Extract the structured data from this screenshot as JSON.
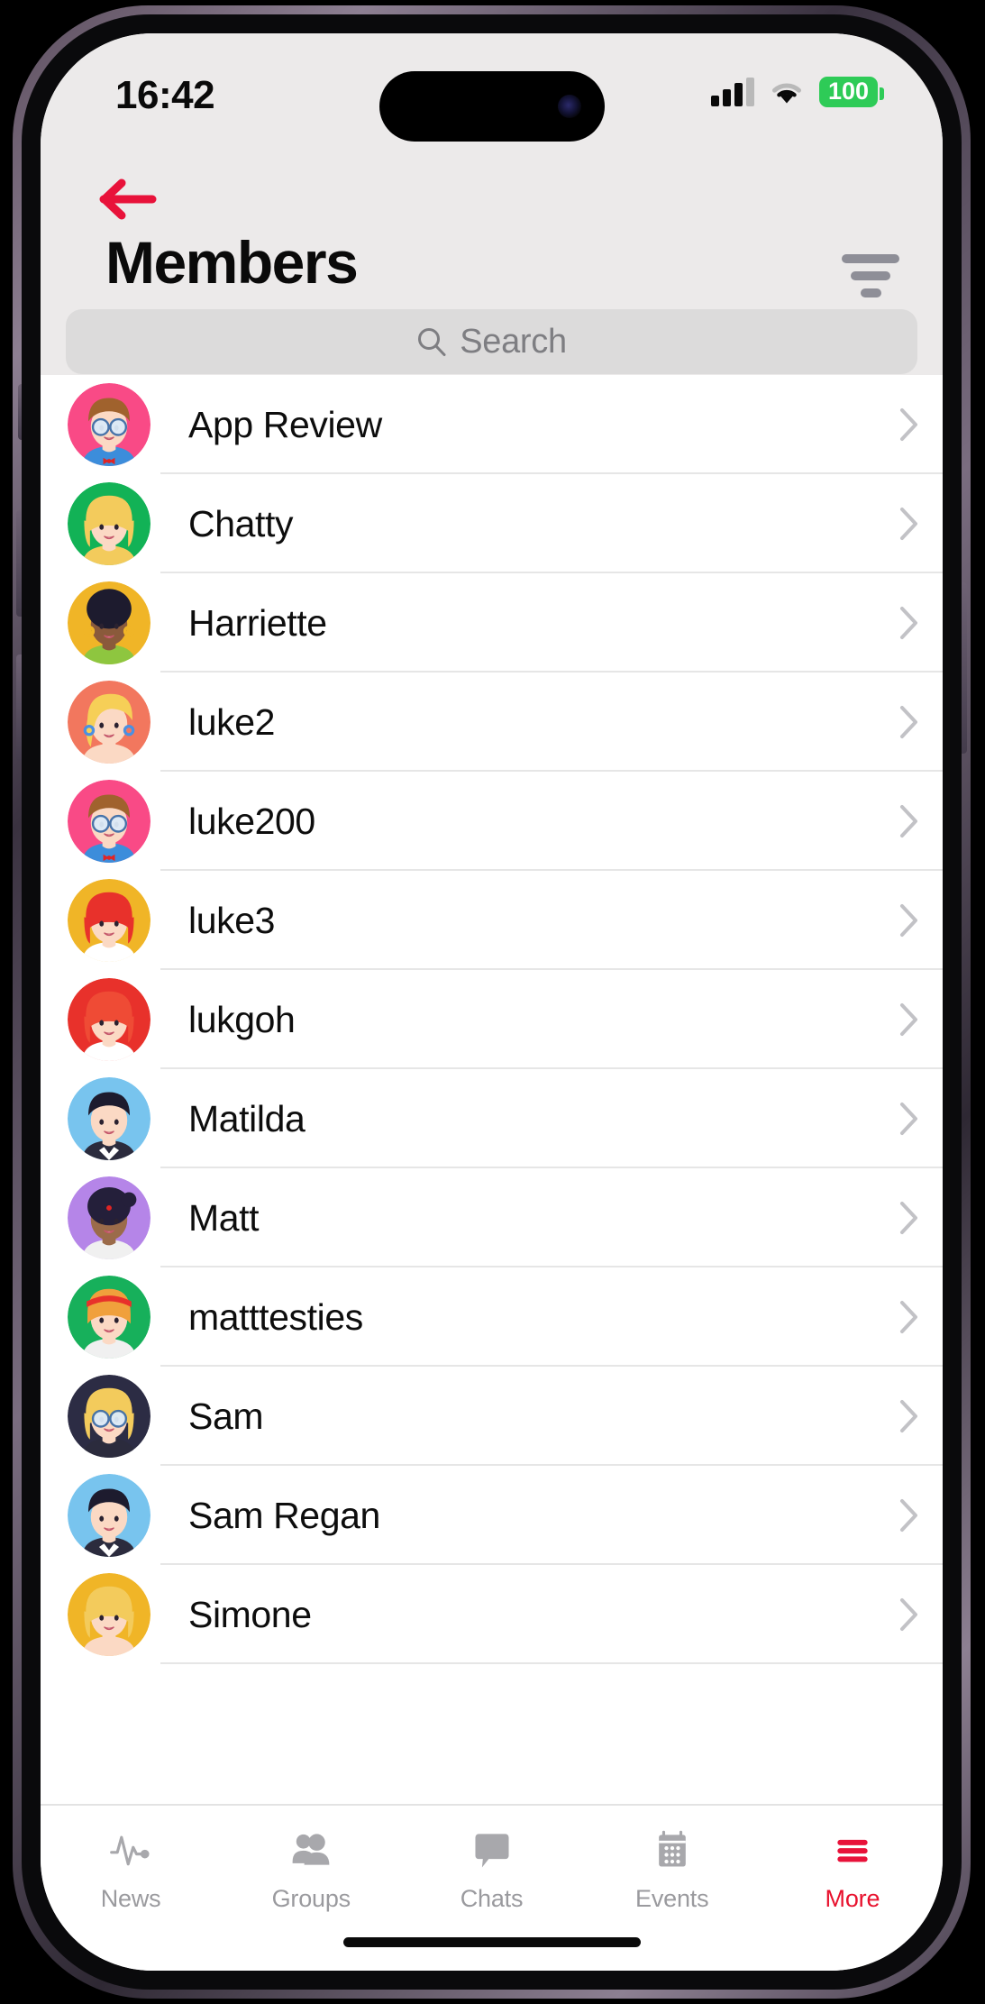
{
  "status_bar": {
    "time": "16:42",
    "battery_level": "100",
    "battery_color": "#2ecb57",
    "signal_icon": "cellular-signal-icon",
    "wifi_icon": "wifi-icon"
  },
  "nav": {
    "back_icon": "back-arrow-icon",
    "back_color": "#e8123a",
    "title": "Members",
    "filter_icon": "filter-icon",
    "filter_color": "#8e8e97"
  },
  "search": {
    "placeholder": "Search",
    "value": "",
    "icon": "search-icon"
  },
  "members": [
    {
      "name": "App Review",
      "avatar": "avatar-glasses-pink",
      "bg": "#f94a86",
      "chevron": "chevron-right-icon"
    },
    {
      "name": "Chatty",
      "avatar": "avatar-blonde-green",
      "bg": "#12b256",
      "chevron": "chevron-right-icon"
    },
    {
      "name": "Harriette",
      "avatar": "avatar-afro-gold",
      "bg": "#f0b527",
      "chevron": "chevron-right-icon"
    },
    {
      "name": "luke2",
      "avatar": "avatar-blonde-coral",
      "bg": "#f2775e",
      "chevron": "chevron-right-icon"
    },
    {
      "name": "luke200",
      "avatar": "avatar-glasses-pink",
      "bg": "#f94a86",
      "chevron": "chevron-right-icon"
    },
    {
      "name": "luke3",
      "avatar": "avatar-redhair-gold",
      "bg": "#f0b527",
      "chevron": "chevron-right-icon"
    },
    {
      "name": "lukgoh",
      "avatar": "avatar-redhair-red",
      "bg": "#e8312b",
      "chevron": "chevron-right-icon"
    },
    {
      "name": "Matilda",
      "avatar": "avatar-suit-blue",
      "bg": "#78c4ee",
      "chevron": "chevron-right-icon"
    },
    {
      "name": "Matt",
      "avatar": "avatar-bindi-purple",
      "bg": "#b585e8",
      "chevron": "chevron-right-icon"
    },
    {
      "name": "matttesties",
      "avatar": "avatar-headband-green",
      "bg": "#17b05b",
      "chevron": "chevron-right-icon"
    },
    {
      "name": "Sam",
      "avatar": "avatar-glasses-navy",
      "bg": "#2c2c44",
      "chevron": "chevron-right-icon"
    },
    {
      "name": "Sam Regan",
      "avatar": "avatar-suit-blue",
      "bg": "#78c4ee",
      "chevron": "chevron-right-icon"
    },
    {
      "name": "Simone",
      "avatar": "avatar-blonde-gold",
      "bg": "#f0b527",
      "chevron": "chevron-right-icon"
    }
  ],
  "tabs": [
    {
      "label": "News",
      "icon": "pulse-icon",
      "active": false
    },
    {
      "label": "Groups",
      "icon": "people-icon",
      "active": false
    },
    {
      "label": "Chats",
      "icon": "chat-bubble-icon",
      "active": false
    },
    {
      "label": "Events",
      "icon": "calendar-icon",
      "active": false
    },
    {
      "label": "More",
      "icon": "hamburger-icon",
      "active": true
    }
  ],
  "colors": {
    "accent": "#e8123a",
    "inactive_tab": "#9a9a9e",
    "header_bg": "#eceaea",
    "search_bg": "#dcdbdb"
  }
}
